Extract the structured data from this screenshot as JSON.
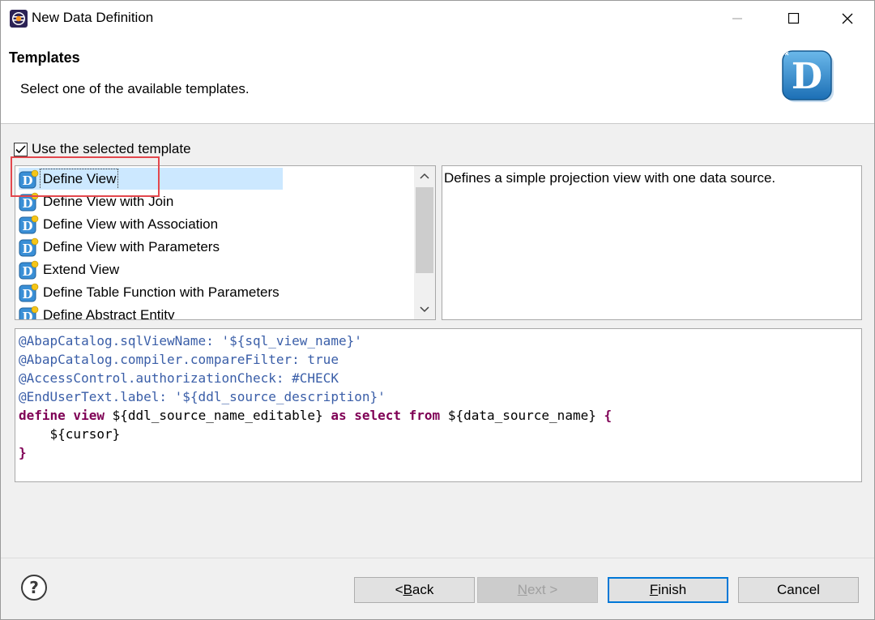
{
  "window": {
    "title": "New Data Definition"
  },
  "header": {
    "title": "Templates",
    "description": "Select one of the available templates."
  },
  "use_template": {
    "label": "Use the selected template",
    "checked": true
  },
  "templates": {
    "items": [
      {
        "label": "Define View",
        "selected": true
      },
      {
        "label": "Define View with Join"
      },
      {
        "label": "Define View with Association"
      },
      {
        "label": "Define View with Parameters"
      },
      {
        "label": "Extend View"
      },
      {
        "label": "Define Table Function with Parameters"
      },
      {
        "label": "Define Abstract Entity"
      }
    ]
  },
  "description": {
    "text": "Defines a simple projection view with one data source."
  },
  "code": {
    "lines": [
      "@AbapCatalog.sqlViewName: '${sql_view_name}'",
      "@AbapCatalog.compiler.compareFilter: true",
      "@AccessControl.authorizationCheck: #CHECK",
      "@EndUserText.label: '${ddl_source_description}'",
      "define view ${ddl_source_name_editable} as select from ${data_source_name} {",
      "    ${cursor}",
      "}"
    ],
    "line5_parts": [
      "define view",
      " ${ddl_source_name_editable} ",
      "as select from",
      " ${data_source_name} ",
      "{"
    ],
    "line6": "    ${cursor}",
    "line7": "}"
  },
  "footer": {
    "back_prefix": "< ",
    "back_mnemonic": "B",
    "back_rest": "ack",
    "next_mnemonic": "N",
    "next_rest": "ext >",
    "finish_mnemonic": "F",
    "finish_rest": "inish",
    "cancel_label": "Cancel"
  },
  "colors": {
    "annotation": "#3a5ea8",
    "keyword": "#7f0055",
    "selection": "#cce8ff",
    "highlight": "#e3474d",
    "default_button_border": "#0078d7"
  }
}
